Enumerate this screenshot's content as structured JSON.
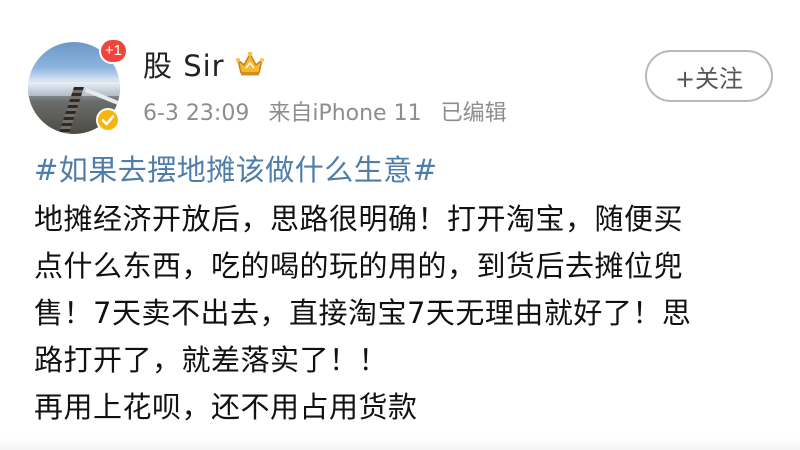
{
  "post": {
    "author": {
      "name": "股 Sir",
      "avatar_badge": "+1",
      "avatar_badge_color": "#f0453a",
      "verified_color": "#f5b70d",
      "crown_icon": "crown-icon"
    },
    "meta": {
      "time": "6-3 23:09",
      "source": "来自iPhone 11",
      "edited": "已编辑"
    },
    "follow_button": {
      "label": "+关注"
    },
    "topic": "#如果去摆地摊该做什么生意#",
    "topic_color": "#4f7daa",
    "body_lines": [
      "地摊经济开放后，思路很明确！打开淘宝，随便买",
      "点什么东西，吃的喝的玩的用的，到货后去摊位兜",
      "售！7天卖不出去，直接淘宝7天无理由就好了！思",
      "路打开了，就差落实了！！",
      "再用上花呗，还不用占用货款"
    ]
  }
}
